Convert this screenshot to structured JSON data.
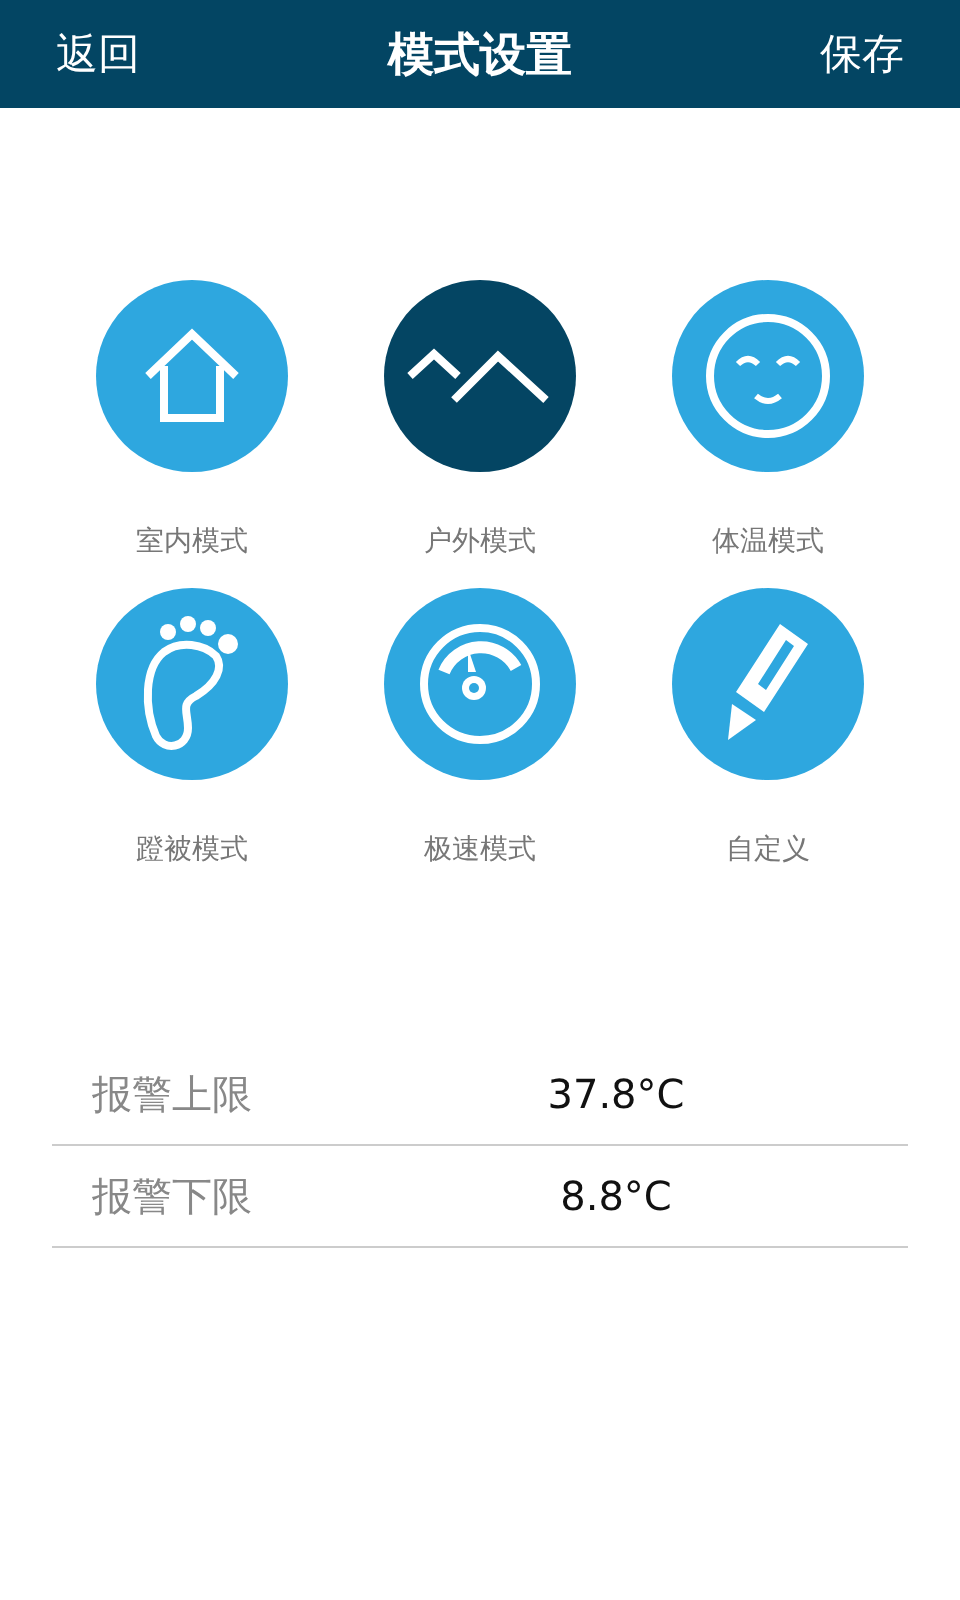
{
  "header": {
    "back": "返回",
    "title": "模式设置",
    "save": "保存"
  },
  "modes": [
    {
      "kind": "house",
      "label": "室内模式",
      "selected": false
    },
    {
      "kind": "mountain",
      "label": "户外模式",
      "selected": true
    },
    {
      "kind": "face",
      "label": "体温模式",
      "selected": false
    },
    {
      "kind": "foot",
      "label": "蹬被模式",
      "selected": false
    },
    {
      "kind": "gauge",
      "label": "极速模式",
      "selected": false
    },
    {
      "kind": "pencil",
      "label": "自定义",
      "selected": false
    }
  ],
  "alarms": [
    {
      "label": "报警上限",
      "value": "37.8°C"
    },
    {
      "label": "报警下限",
      "value": "8.8°C"
    }
  ]
}
